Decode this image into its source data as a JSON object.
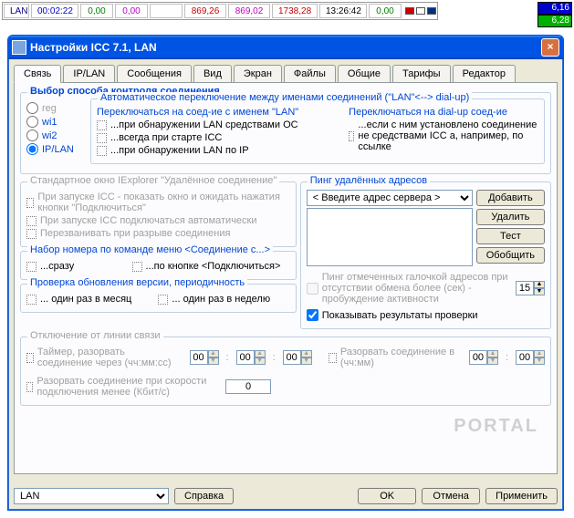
{
  "meter": {
    "label": "LAN",
    "cells": [
      "00:02:22",
      "0,00",
      "0,00",
      "",
      "869,26",
      "869,02",
      "1738,28",
      "13:26:42",
      "0,00"
    ]
  },
  "side_badges": {
    "top": "6,16",
    "bottom": "6,28"
  },
  "window": {
    "title": "Настройки ICC 7.1, LAN",
    "tabs": [
      "Связь",
      "IP/LAN",
      "Сообщения",
      "Вид",
      "Экран",
      "Файлы",
      "Общие",
      "Тарифы",
      "Редактор"
    ]
  },
  "conn_method": {
    "legend": "Выбор способа контроля соединения",
    "radios": [
      "reg",
      "wi1",
      "wi2",
      "IP/LAN"
    ],
    "auto_switch": "Автоматическое переключение между именами соединений (\"LAN\"<--> dial-up)",
    "switch_lan_legend": "Переключаться на соед-ие с именем \"LAN\"",
    "switch_lan_opts": [
      "...при обнаружении LAN средствами ОС",
      "...всегда при старте ICC",
      "...при обнаружении LAN по IP"
    ],
    "switch_dial_legend": "Переключаться на dial-up соед-ие",
    "switch_dial_opt": "...если с ним установлено соединение не средствами ICC а, например, по ссылке"
  },
  "iexp": {
    "legend": "Стандартное окно IExplorer \"Удалённое соединение\"",
    "opts": [
      "При запуске ICC - показать окно и ожидать нажатия кнопки \"Подключиться\"",
      "При запуске ICC подключаться автоматически",
      "Перезванивать при разрыве соединения"
    ]
  },
  "dial_cmd": {
    "legend": "Набор номера по команде меню <Соединение с...>",
    "opts": [
      "...сразу",
      "...по кнопке <Подключиться>"
    ]
  },
  "upd": {
    "legend": "Проверка обновления версии, периодичность",
    "opts": [
      "... один раз в месяц",
      "... один раз в неделю"
    ]
  },
  "ping": {
    "legend": "Пинг удалённых адресов",
    "placeholder": "< Введите адрес сервера >",
    "buttons": {
      "add": "Добавить",
      "del": "Удалить",
      "test": "Тест",
      "gen": "Обобщить"
    },
    "note": "Пинг отмеченных галочкой адресов при отсутствии обмена более (сек) - пробуждение активности",
    "sec": "15",
    "show": "Показывать результаты проверки"
  },
  "disc": {
    "legend": "Отключение от линии связи",
    "timer": "Таймер, разорвать соединение через (чч:мм:сс)",
    "t1": "00",
    "t2": "00",
    "t3": "00",
    "at": "Разорвать соединение в (чч:мм)",
    "a1": "00",
    "a2": "00",
    "speed": "Разорвать соединение при скорости подключения менее (Кбит/с)",
    "spd_val": "0"
  },
  "footer": {
    "profile": "LAN",
    "help": "Справка",
    "ok": "OK",
    "cancel": "Отмена",
    "apply": "Применить"
  },
  "watermark": "PORTAL"
}
